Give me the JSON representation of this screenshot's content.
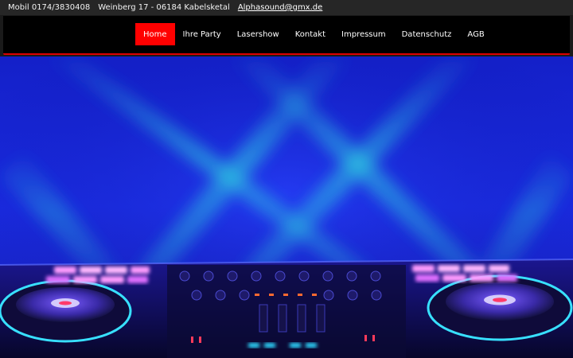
{
  "topbar": {
    "phone": "Mobil 0174/3830408",
    "address": "Weinberg 17 - 06184 Kabelsketal",
    "email": "Alphasound@gmx.de"
  },
  "nav": {
    "items": [
      {
        "label": "Home",
        "active": true
      },
      {
        "label": "Ihre Party",
        "active": false
      },
      {
        "label": "Lasershow",
        "active": false
      },
      {
        "label": "Kontakt",
        "active": false
      },
      {
        "label": "Impressum",
        "active": false
      },
      {
        "label": "Datenschutz",
        "active": false
      },
      {
        "label": "AGB",
        "active": false
      }
    ]
  },
  "colors": {
    "accent": "#ff0000",
    "nav_bg": "#000000",
    "topbar_bg": "#262626",
    "hero_blue": "#1a22d8",
    "beam_cyan": "#2ee8e0"
  }
}
